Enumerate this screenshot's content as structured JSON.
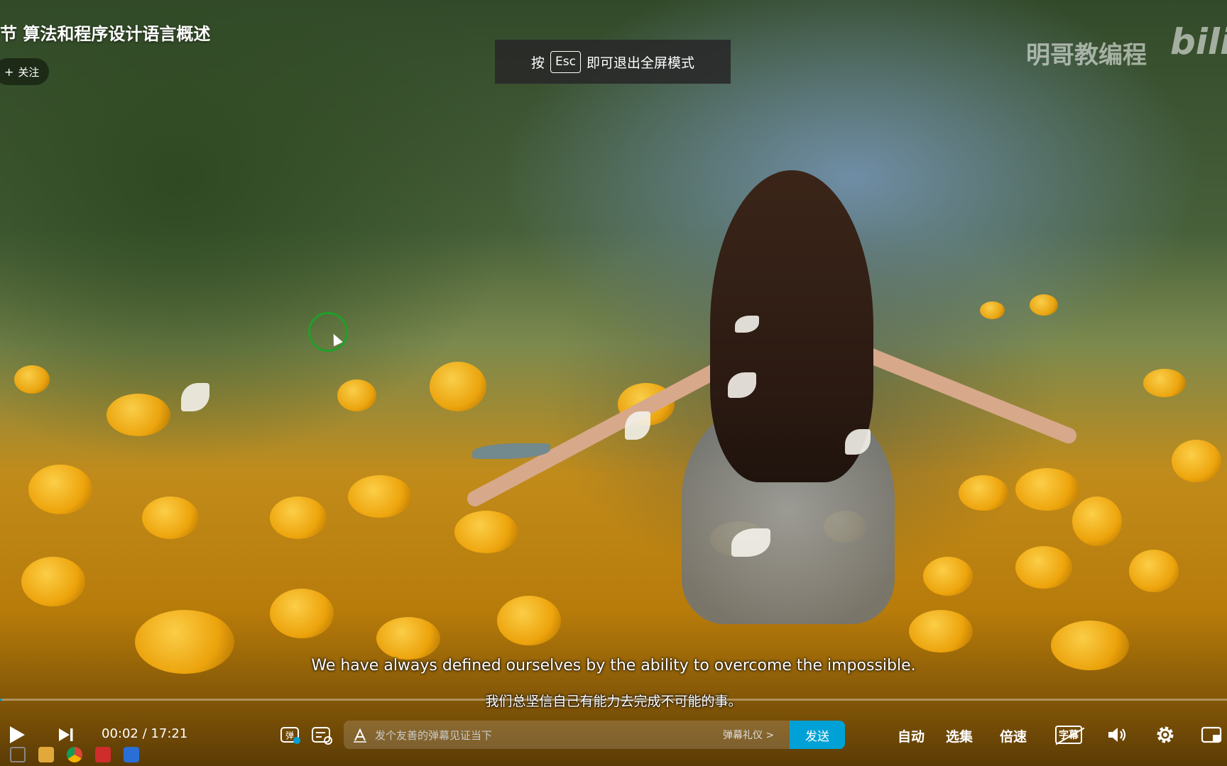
{
  "video": {
    "title": "节 算法和程序设计语言概述",
    "follow_label": "关注",
    "follow_icon": "plus-icon",
    "watermark_text": "明哥教编程",
    "watermark_logo": "bili"
  },
  "esc_toast": {
    "before": "按",
    "key": "Esc",
    "after": "即可退出全屏模式"
  },
  "subtitles": {
    "english": "We have always defined ourselves by the ability to overcome the impossible.",
    "chinese": "我们总坚信自己有能力去完成不可能的事。"
  },
  "player": {
    "current_time": "00:02",
    "separator": "/",
    "duration": "17:21",
    "progress_fraction": 0.002,
    "danmaku_toggle_label": "弹",
    "danmaku_placeholder": "发个友善的弹幕见证当下",
    "danmaku_etiquette": "弹幕礼仪 >",
    "send_label": "发送",
    "auto_label": "自动",
    "episodes_label": "选集",
    "speed_label": "倍速",
    "subtitle_label": "字幕",
    "accent_color": "#00a1d6"
  },
  "icons": {
    "play": "play-icon",
    "next": "next-icon",
    "danmaku_toggle": "danmaku-toggle-icon",
    "danmaku_settings": "danmaku-settings-icon",
    "danmaku_style": "text-style-icon",
    "volume": "volume-icon",
    "settings": "gear-icon",
    "web_fullscreen": "web-fullscreen-icon"
  }
}
